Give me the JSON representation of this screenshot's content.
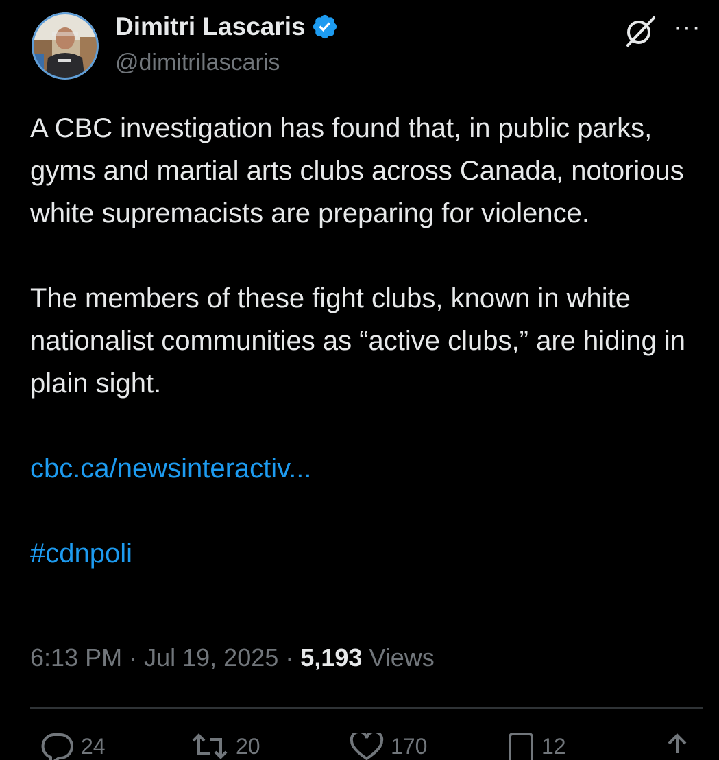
{
  "author": {
    "display_name": "Dimitri Lascaris",
    "handle": "@dimitrilascaris",
    "verified": true
  },
  "header": {
    "grok_icon": "grok-slash-icon",
    "more_label": "···"
  },
  "tweet": {
    "paragraphs": [
      "A CBC investigation has found that, in public parks, gyms and martial arts clubs across Canada, notorious white supremacists are preparing for violence.",
      "The members of these fight clubs, known in white nationalist communities as “active clubs,” are hiding in plain sight."
    ],
    "link_text": "cbc.ca/newsinteractiv...",
    "hashtag": "#cdnpoli"
  },
  "meta": {
    "time": "6:13 PM",
    "separator": "·",
    "date": "Jul 19, 2025",
    "views_count": "5,193",
    "views_label": "Views"
  },
  "actions": {
    "reply_count": "24",
    "repost_count": "20",
    "like_count": "170",
    "bookmark_count": "12"
  },
  "colors": {
    "background": "#000000",
    "text_primary": "#e7e9ea",
    "text_secondary": "#71767b",
    "accent": "#1d9bf0",
    "divider": "#2f3336"
  }
}
